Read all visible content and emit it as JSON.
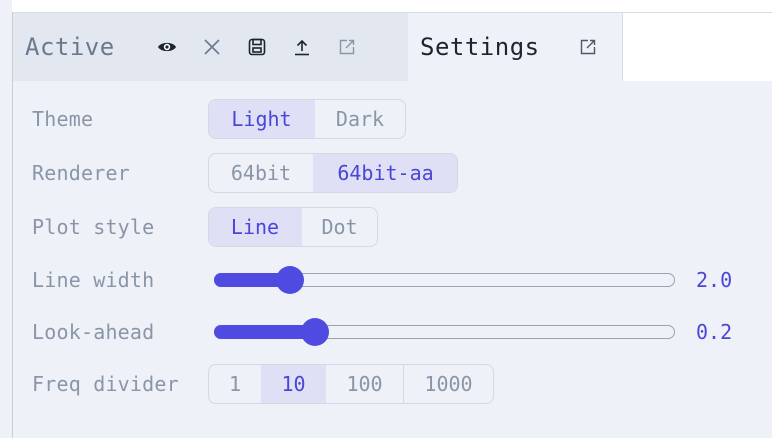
{
  "tabs": {
    "active": {
      "label": "Active"
    },
    "settings": {
      "label": "Settings"
    }
  },
  "icons": {
    "active_tab": [
      "eye-icon",
      "close-icon",
      "save-icon",
      "upload-icon",
      "external-link-icon"
    ],
    "settings_tab": [
      "external-link-icon"
    ]
  },
  "settings": {
    "theme": {
      "label": "Theme",
      "options": [
        "Light",
        "Dark"
      ],
      "selected": "Light"
    },
    "renderer": {
      "label": "Renderer",
      "options": [
        "64bit",
        "64bit-aa"
      ],
      "selected": "64bit-aa"
    },
    "plot_style": {
      "label": "Plot style",
      "options": [
        "Line",
        "Dot"
      ],
      "selected": "Line"
    },
    "line_width": {
      "label": "Line width",
      "value": "2.0",
      "fraction": 0.165
    },
    "look_ahead": {
      "label": "Look-ahead",
      "value": "0.2",
      "fraction": 0.22
    },
    "freq_divider": {
      "label": "Freq divider",
      "options": [
        "1",
        "10",
        "100",
        "1000"
      ],
      "selected": "10"
    }
  },
  "colors": {
    "accent": "#4f4ae0",
    "accent_text": "#4a46d6",
    "selected_bg": "#dfe0f5",
    "label_text": "#8a96a8",
    "panel_bg": "#eef1f7"
  }
}
